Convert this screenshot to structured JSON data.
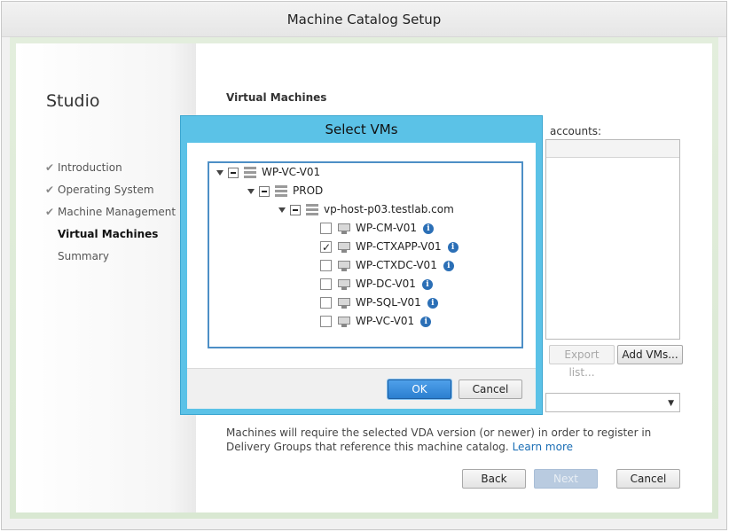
{
  "window": {
    "title": "Machine Catalog Setup"
  },
  "sidebar": {
    "brand": "Studio",
    "items": [
      {
        "label": "Introduction",
        "state": "done"
      },
      {
        "label": "Operating System",
        "state": "done"
      },
      {
        "label": "Machine Management",
        "state": "done"
      },
      {
        "label": "Virtual Machines",
        "state": "active"
      },
      {
        "label": "Summary",
        "state": "pending"
      }
    ]
  },
  "main": {
    "section_title": "Virtual Machines",
    "accounts_label": "accounts:",
    "export_list_label": "Export list...",
    "add_vms_label": "Add VMs...",
    "info_text": "Machines will require the selected VDA version (or newer) in order to register in Delivery Groups that reference this machine catalog.",
    "learn_more": "Learn more",
    "back_label": "Back",
    "next_label": "Next",
    "cancel_label": "Cancel"
  },
  "dialog": {
    "title": "Select VMs",
    "tree": {
      "root": "WP-VC-V01",
      "datacenter": "PROD",
      "host": "vp-host-p03.testlab.com",
      "vms": [
        {
          "name": "WP-CM-V01",
          "checked": false
        },
        {
          "name": "WP-CTXAPP-V01",
          "checked": true
        },
        {
          "name": "WP-CTXDC-V01",
          "checked": false
        },
        {
          "name": "WP-DC-V01",
          "checked": false
        },
        {
          "name": "WP-SQL-V01",
          "checked": false
        },
        {
          "name": "WP-VC-V01",
          "checked": false
        }
      ]
    },
    "ok_label": "OK",
    "cancel_label": "Cancel"
  },
  "colors": {
    "dialog_frame": "#5bc2e7",
    "link": "#1a6eb5",
    "ok_button": "#2b7fd0"
  },
  "icons": [
    "check-icon",
    "server-icon",
    "vm-monitor-icon",
    "info-icon",
    "expand-arrow-icon",
    "dropdown-arrow-icon"
  ]
}
